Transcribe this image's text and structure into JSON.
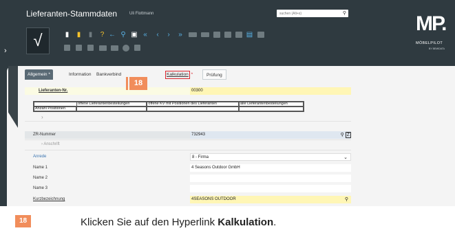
{
  "header": {
    "title": "Lieferanten-Stammdaten",
    "user": "Uli Flottmann",
    "search_placeholder": "suchen (Alt+s)"
  },
  "logo": {
    "mark": "MP.",
    "name": "MÖBELPILOT",
    "sub": "BY BEMIDATA"
  },
  "toolbar": {
    "confirm": "√",
    "icons": [
      "new-doc-icon",
      "copy-icon",
      "delete-icon",
      "help-icon",
      "back-icon",
      "search-icon",
      "print-icon",
      "first-icon",
      "prev-icon",
      "next-icon",
      "last-icon",
      "chart-icon"
    ]
  },
  "tabs": [
    {
      "label": "Allgemein",
      "required": "*",
      "active": true
    },
    {
      "label": "Information"
    },
    {
      "label": "Bankverbind"
    },
    {
      "label": "Kalkulation",
      "required": "*"
    },
    {
      "label": "Prüfung"
    }
  ],
  "form": {
    "lieferant_label": "Lieferanten-Nr.",
    "lieferant_value": "00300",
    "positions_headers": [
      "offene Lieferantenbestellungen",
      "offene KV mit Positionen des Lieferanten",
      "alle Lieferantenbestellungen"
    ],
    "positions_count_label": "Anzahl Positionen",
    "zr_label": "ZR-Nummer",
    "zr_value": "732943",
    "anschrift_label": "Anschrift",
    "anrede_label": "Anrede",
    "anrede_value": "8 - Firma",
    "name1_label": "Name 1",
    "name1_value": "4 Seasons Outdoor GmbH",
    "name2_label": "Name 2",
    "name3_label": "Name 3",
    "kurz_label": "Kurzbezeichnung",
    "kurz_value": "4SEASONS OUTDOOR"
  },
  "marker": {
    "number": "18"
  },
  "instruction": {
    "prefix": "Klicken Sie auf den Hyperlink ",
    "target": "Kalkulation",
    "suffix": "."
  },
  "colors": {
    "app_bg": "#2f3a40",
    "panel_bg": "#f4f4f4",
    "accent": "#5ab4e8",
    "highlight_required": "#fff6b5",
    "marker": "#f18d5b",
    "callout": "#d8232a"
  }
}
